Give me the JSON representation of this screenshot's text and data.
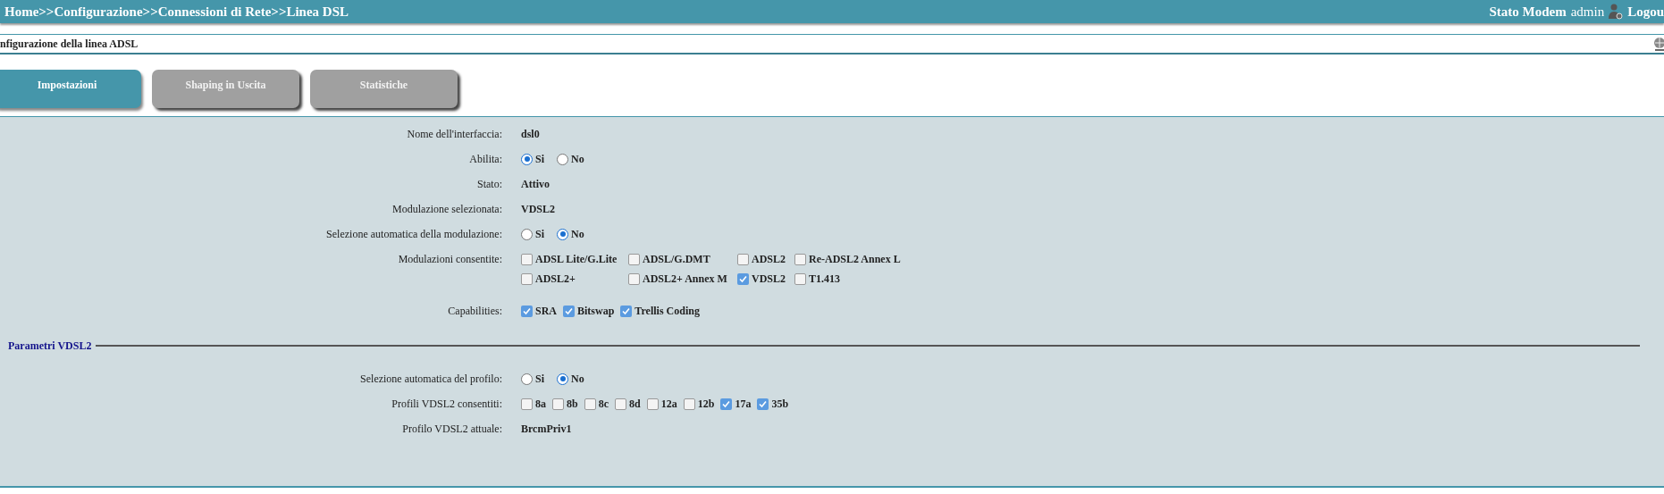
{
  "header": {
    "breadcrumb": "Home>>Configurazione>>Connessioni di Rete>>Linea DSL",
    "status_link": "Stato Modem",
    "user": "admin",
    "logout": "Logou"
  },
  "page_title": "nfigurazione della linea ADSL",
  "tabs": [
    {
      "label": "Impostazioni",
      "selected": true
    },
    {
      "label": "Shaping in Uscita",
      "selected": false
    },
    {
      "label": "Statistiche",
      "selected": false
    }
  ],
  "fields": [
    {
      "kind": "text",
      "label": "Nome dell'interfaccia:",
      "value": "dsl0"
    },
    {
      "kind": "radio",
      "label": "Abilita:",
      "options": [
        {
          "label": "Si",
          "selected": true
        },
        {
          "label": "No",
          "selected": false
        }
      ]
    },
    {
      "kind": "text",
      "label": "Stato:",
      "value": "Attivo"
    },
    {
      "kind": "text",
      "label": "Modulazione selezionata:",
      "value": "VDSL2"
    },
    {
      "kind": "radio",
      "label": "Selezione automatica della modulazione:",
      "options": [
        {
          "label": "Si",
          "selected": false
        },
        {
          "label": "No",
          "selected": true
        }
      ]
    },
    {
      "kind": "grid",
      "label": "Modulazioni consentite:",
      "options": [
        {
          "label": "ADSL Lite/G.Lite",
          "checked": false
        },
        {
          "label": "ADSL/G.DMT",
          "checked": false
        },
        {
          "label": "ADSL2",
          "checked": false
        },
        {
          "label": "Re-ADSL2 Annex L",
          "checked": false
        },
        {
          "label": "ADSL2+",
          "checked": false
        },
        {
          "label": "ADSL2+ Annex M",
          "checked": false
        },
        {
          "label": "VDSL2",
          "checked": true
        },
        {
          "label": "T1.413",
          "checked": false
        }
      ]
    },
    {
      "kind": "checks",
      "label": "Capabilities:",
      "options": [
        {
          "label": "SRA",
          "checked": true
        },
        {
          "label": "Bitswap",
          "checked": true
        },
        {
          "label": "Trellis Coding",
          "checked": true
        }
      ]
    }
  ],
  "section": {
    "title": "Parametri VDSL2",
    "fields": [
      {
        "kind": "radio",
        "label": "Selezione automatica del profilo:",
        "options": [
          {
            "label": "Si",
            "selected": false
          },
          {
            "label": "No",
            "selected": true
          }
        ]
      },
      {
        "kind": "checks",
        "label": "Profili VDSL2 consentiti:",
        "options": [
          {
            "label": "8a",
            "checked": false
          },
          {
            "label": "8b",
            "checked": false
          },
          {
            "label": "8c",
            "checked": false
          },
          {
            "label": "8d",
            "checked": false
          },
          {
            "label": "12a",
            "checked": false
          },
          {
            "label": "12b",
            "checked": false
          },
          {
            "label": "17a",
            "checked": true
          },
          {
            "label": "35b",
            "checked": true
          }
        ]
      },
      {
        "kind": "text",
        "label": "Profilo VDSL2 attuale:",
        "value": "BrcmPriv1"
      }
    ]
  }
}
